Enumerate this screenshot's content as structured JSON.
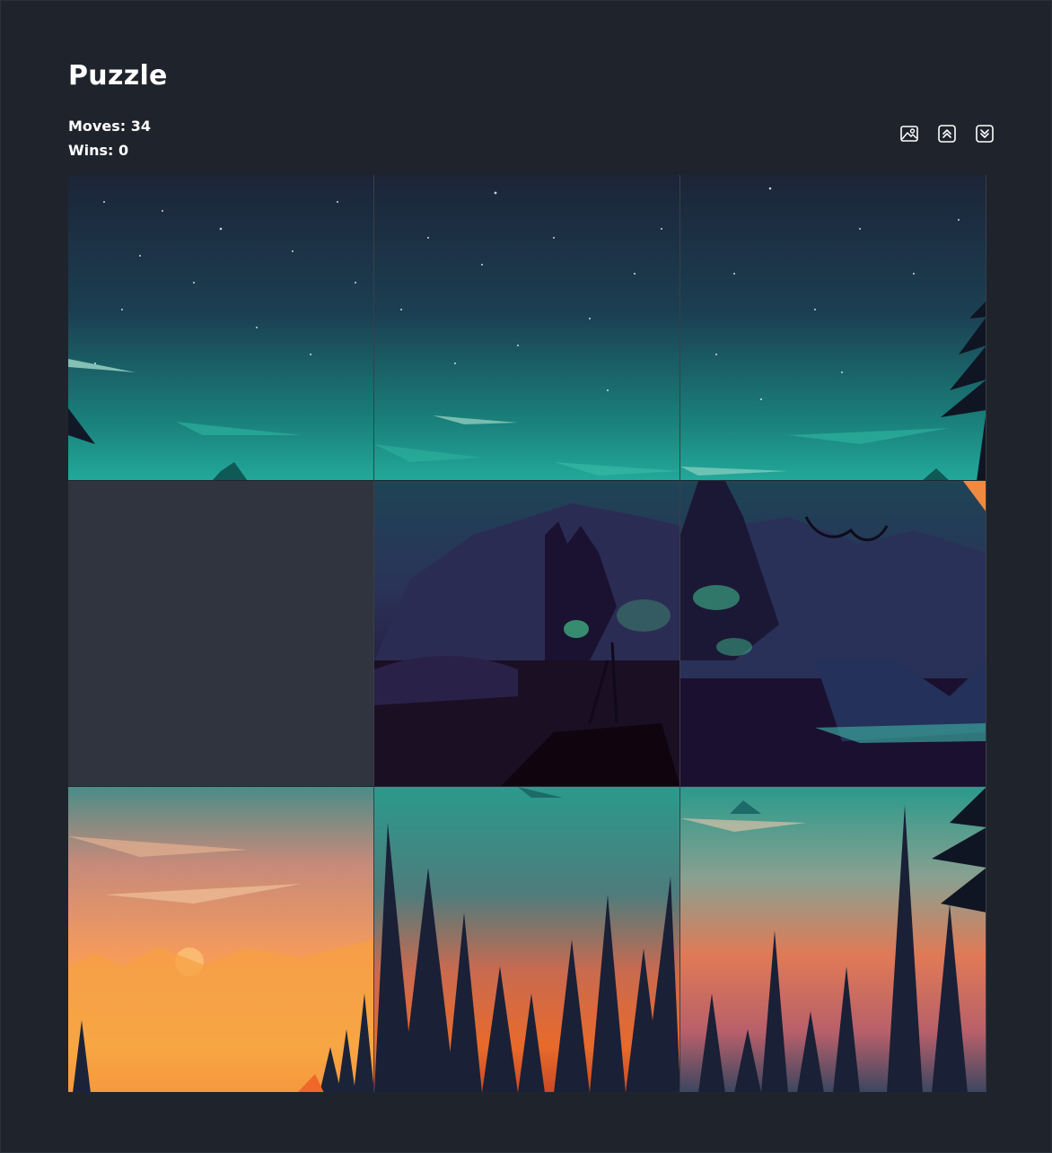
{
  "header": {
    "title": "Puzzle"
  },
  "stats": {
    "moves_label": "Moves:",
    "moves": 34,
    "wins_label": "Wins:",
    "wins": 0
  },
  "toolbar": {
    "buttons": [
      {
        "name": "show-image",
        "icon": "image-icon"
      },
      {
        "name": "move-up",
        "icon": "double-chevron-up-icon"
      },
      {
        "name": "move-down",
        "icon": "double-chevron-down-icon"
      }
    ]
  },
  "board": {
    "grid_size": 3,
    "empty_cell": {
      "row": 2,
      "col": 1
    },
    "scene": "illustrated forest landscape at dusk with starry teal sky",
    "tiles": [
      {
        "row": 1,
        "col": 1,
        "content": "starry teal sky, left"
      },
      {
        "row": 1,
        "col": 2,
        "content": "starry teal sky, center"
      },
      {
        "row": 1,
        "col": 3,
        "content": "starry teal sky, right with pine branches"
      },
      {
        "row": 2,
        "col": 1,
        "content": "empty"
      },
      {
        "row": 2,
        "col": 2,
        "content": "dark purple hillside with glowing plants"
      },
      {
        "row": 2,
        "col": 3,
        "content": "dark purple rocks and water"
      },
      {
        "row": 3,
        "col": 1,
        "content": "orange sunset sky over forest"
      },
      {
        "row": 3,
        "col": 2,
        "content": "dark pines over red glowing valley"
      },
      {
        "row": 3,
        "col": 3,
        "content": "pine silhouettes in orange haze"
      }
    ]
  },
  "colors": {
    "background": "#1f242c",
    "empty_tile": "#2f343e",
    "sky_top": "#1c2a3c",
    "sky_bottom": "#1fa08e",
    "dusk_purple": "#2a1838",
    "sunset_orange": "#f7a84a",
    "pine_dark": "#151a2c"
  }
}
